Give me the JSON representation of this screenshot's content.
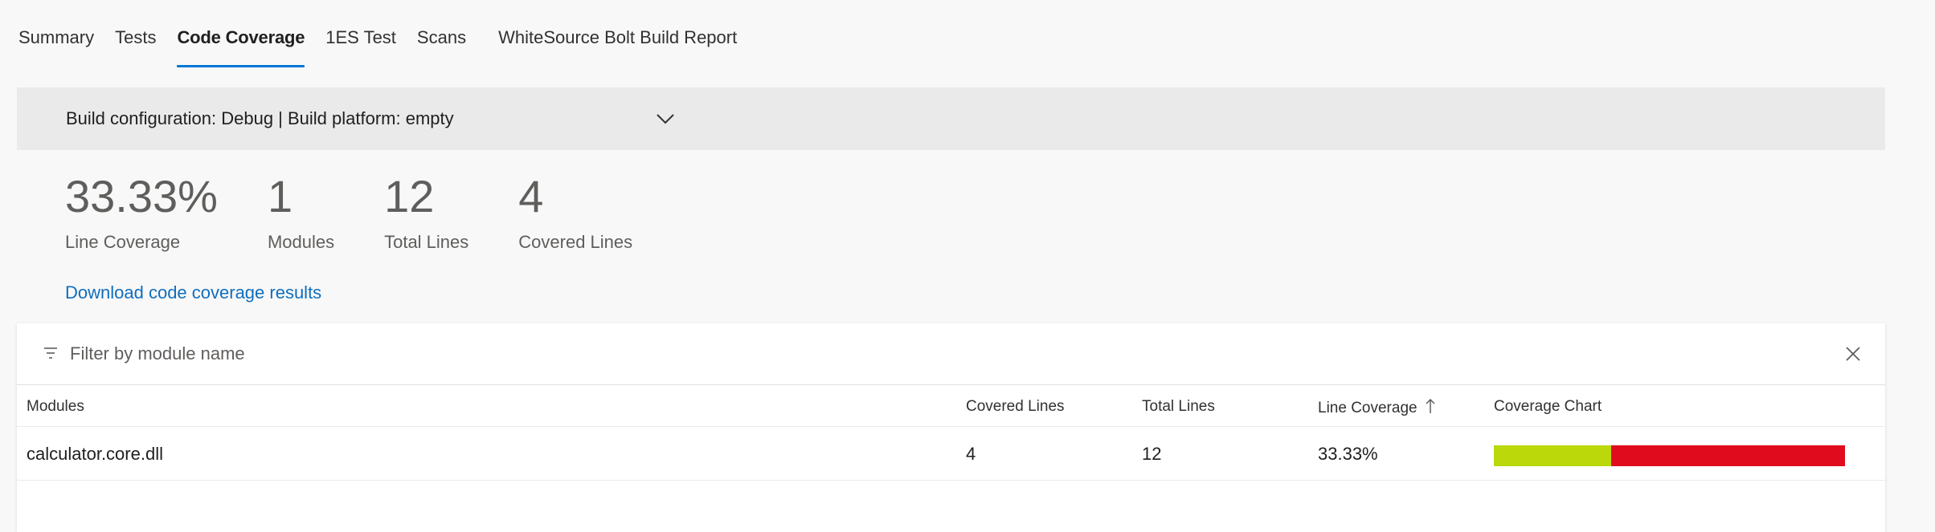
{
  "tabs": [
    {
      "label": "Summary",
      "active": false
    },
    {
      "label": "Tests",
      "active": false
    },
    {
      "label": "Code Coverage",
      "active": true
    },
    {
      "label": "1ES Test",
      "active": false
    },
    {
      "label": "Scans",
      "active": false
    },
    {
      "label": "WhiteSource Bolt Build Report",
      "active": false
    }
  ],
  "config": {
    "text": "Build configuration: Debug | Build platform: empty",
    "dropdown_icon": "chevron-down-icon"
  },
  "stats": [
    {
      "value": "33.33%",
      "label": "Line Coverage"
    },
    {
      "value": "1",
      "label": "Modules"
    },
    {
      "value": "12",
      "label": "Total Lines"
    },
    {
      "value": "4",
      "label": "Covered Lines"
    }
  ],
  "download_link": "Download code coverage results",
  "filter": {
    "placeholder": "Filter by module name",
    "value": "",
    "icon": "filter-icon",
    "clear_icon": "close-icon"
  },
  "table": {
    "headers": {
      "module": "Modules",
      "covered": "Covered Lines",
      "total": "Total Lines",
      "line_coverage": "Line Coverage",
      "chart": "Coverage Chart"
    },
    "sort_icon": "sort-ascending-icon",
    "rows": [
      {
        "module": "calculator.core.dll",
        "covered": "4",
        "total": "12",
        "line_coverage": "33.33%",
        "coverage_fraction": 0.3333
      }
    ]
  },
  "colors": {
    "accent": "#0078d4",
    "link": "#106ebe",
    "covered": "#bad80a",
    "uncovered": "#e00b1c"
  }
}
